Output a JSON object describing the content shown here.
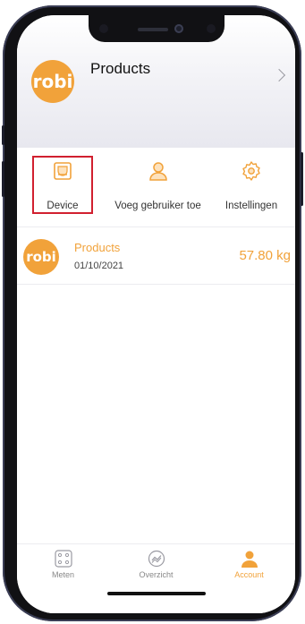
{
  "header": {
    "logo_text": "robi",
    "title": "Products",
    "chevron_icon": "chevron-right-icon"
  },
  "menu": {
    "items": [
      {
        "label": "Device",
        "icon": "device-icon"
      },
      {
        "label": "Voeg gebruiker toe",
        "icon": "user-icon"
      },
      {
        "label": "Instellingen",
        "icon": "gear-icon"
      }
    ]
  },
  "entry": {
    "logo_text": "robi",
    "title": "Products",
    "date": "01/10/2021",
    "weight": "57.80 kg"
  },
  "tabbar": {
    "tabs": [
      {
        "label": "Meten",
        "icon": "scale-icon"
      },
      {
        "label": "Overzicht",
        "icon": "chart-icon"
      },
      {
        "label": "Account",
        "icon": "account-icon",
        "active": true
      }
    ]
  },
  "colors": {
    "accent": "#f1a23a",
    "highlight": "#d1202f"
  }
}
